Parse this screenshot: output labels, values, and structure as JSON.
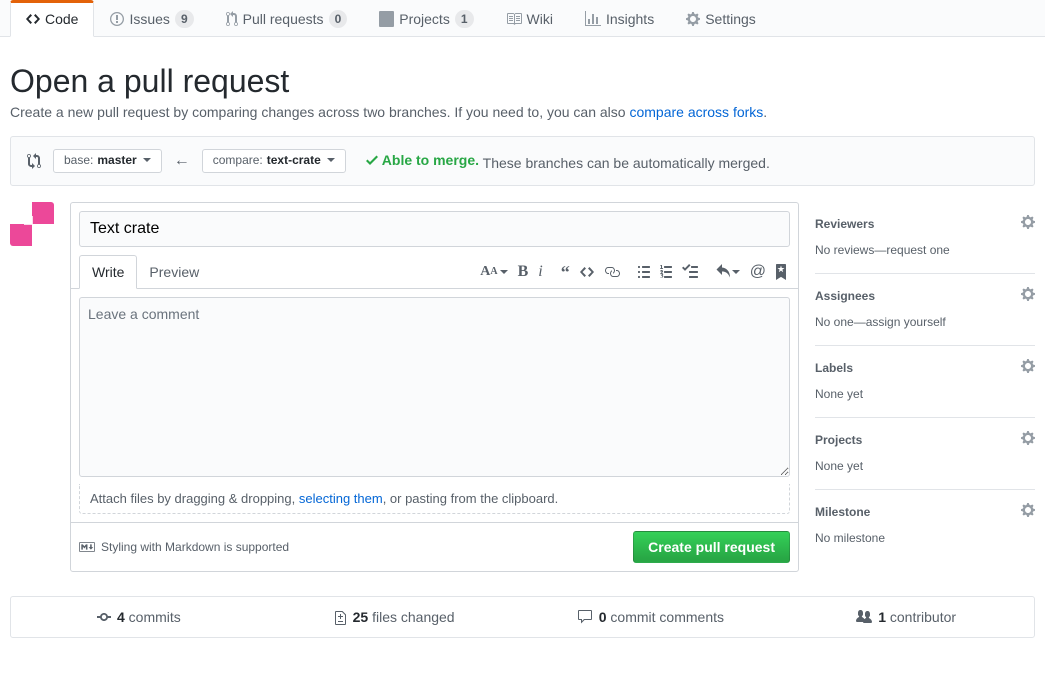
{
  "tabs": {
    "code": "Code",
    "issues": "Issues",
    "issues_count": "9",
    "pulls": "Pull requests",
    "pulls_count": "0",
    "projects": "Projects",
    "projects_count": "1",
    "wiki": "Wiki",
    "insights": "Insights",
    "settings": "Settings"
  },
  "header": {
    "title": "Open a pull request",
    "subtitle_pre": "Create a new pull request by comparing changes across two branches. If you need to, you can also ",
    "subtitle_link": "compare across forks",
    "subtitle_post": "."
  },
  "range": {
    "base_label": "base: ",
    "base_value": "master",
    "compare_label": "compare: ",
    "compare_value": "text-crate",
    "merge_ok": "Able to merge.",
    "merge_text": " These branches can be automatically merged."
  },
  "form": {
    "title_value": "Text crate",
    "write_tab": "Write",
    "preview_tab": "Preview",
    "placeholder": "Leave a comment",
    "attach_pre": "Attach files by dragging & dropping, ",
    "attach_link": "selecting them",
    "attach_post": ", or pasting from the clipboard.",
    "md_hint": "Styling with Markdown is supported",
    "submit": "Create pull request"
  },
  "sidebar": {
    "reviewers": {
      "title": "Reviewers",
      "body": "No reviews—request one"
    },
    "assignees": {
      "title": "Assignees",
      "body_pre": "No one—",
      "body_link": "assign yourself"
    },
    "labels": {
      "title": "Labels",
      "body": "None yet"
    },
    "projects": {
      "title": "Projects",
      "body": "None yet"
    },
    "milestone": {
      "title": "Milestone",
      "body": "No milestone"
    }
  },
  "stats": {
    "commits_n": "4",
    "commits": " commits",
    "files_n": "25",
    "files": " files changed",
    "comments_n": "0",
    "comments": " commit comments",
    "contrib_n": "1",
    "contrib": " contributor"
  }
}
